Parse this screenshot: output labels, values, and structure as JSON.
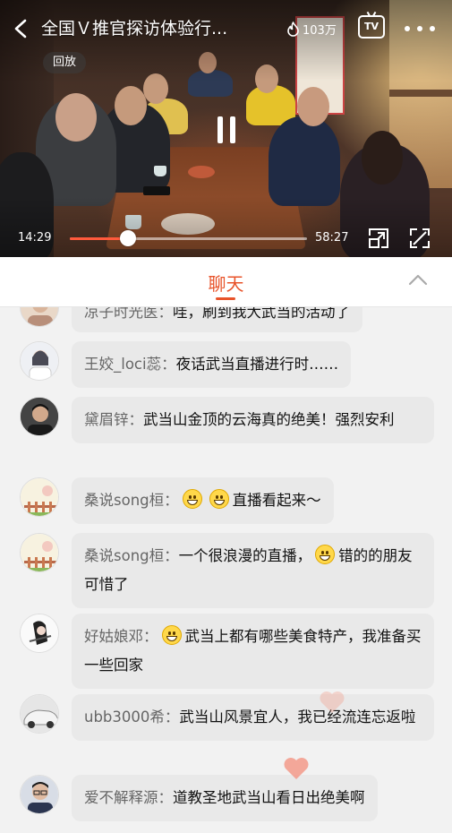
{
  "video": {
    "title": "全国Ｖ推官探访体验行...",
    "heat": "103万",
    "tv_label": "TV",
    "replay_label": "回放",
    "current_time": "14:29",
    "total_time": "58:27",
    "progress_fraction": 0.247
  },
  "tab": {
    "chat_label": "聊天"
  },
  "colors": {
    "accent": "#e8532a",
    "bubble": "#e9e9e9",
    "background": "#f2f2f2"
  },
  "messages": [
    {
      "nick": "凉子时光医：",
      "text": "哇，刷到我大武当的活动了",
      "emojis_before_text": 0,
      "avatar": "portrait-avatar"
    },
    {
      "nick": "王姣_loci蕊：",
      "text": "夜话武当直播进行时……",
      "emojis_before_text": 0,
      "avatar": "girl-avatar"
    },
    {
      "nick": "黛眉锌：",
      "text": "武当山金顶的云海真的绝美！强烈安利",
      "emojis_before_text": 0,
      "avatar": "man-avatar"
    },
    {
      "nick": "桑说song桓：",
      "text": "直播看起来～",
      "emojis_before_text": 2,
      "avatar": "garden-avatar"
    },
    {
      "nick": "桑说song桓：",
      "text_before": "一个很浪漫的直播，",
      "text": "错的的朋友可惜了",
      "emojis_before_text": 1,
      "avatar": "garden-avatar"
    },
    {
      "nick": "好姑娘邓：",
      "text": "武当上都有哪些美食特产，我准备买一些回家",
      "emojis_before_text": 1,
      "avatar": "sketch-avatar"
    },
    {
      "nick": "ubb3000希：",
      "text": "武当山风景宜人，我已经流连忘返啦",
      "emojis_before_text": 0,
      "avatar": "car-avatar"
    },
    {
      "nick": "爱不解释源：",
      "text": "道教圣地武当山看日出绝美啊",
      "emojis_before_text": 0,
      "avatar": "glasses-avatar"
    }
  ],
  "icons": {
    "back": "back-arrow-icon",
    "heat": "flame-icon",
    "more": "more-dots-icon",
    "pause": "pause-icon",
    "pip": "picture-in-picture-icon",
    "fullscreen": "fullscreen-icon",
    "collapse": "chevron-up-icon",
    "emoji": "grin-emoji-icon",
    "heart": "heart-icon"
  }
}
